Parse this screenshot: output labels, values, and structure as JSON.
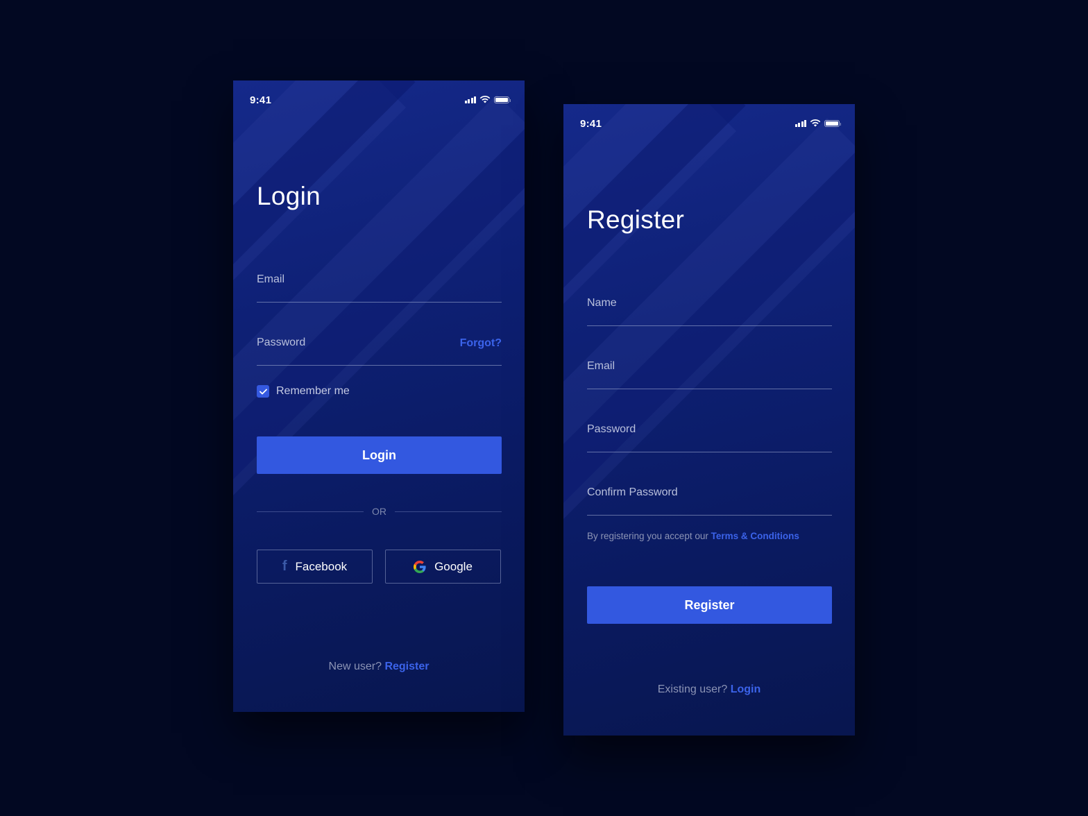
{
  "colors": {
    "background": "#020822",
    "accent": "#3358e0",
    "link": "#3b63ea",
    "label": "#b9c0dc",
    "muted": "#8c94b5"
  },
  "login": {
    "status_bar": {
      "time": "9:41",
      "icons": [
        "signal-icon",
        "wifi-icon",
        "battery-icon"
      ]
    },
    "title": "Login",
    "fields": {
      "email": {
        "label": "Email",
        "value": ""
      },
      "password": {
        "label": "Password",
        "value": ""
      }
    },
    "forgot_label": "Forgot?",
    "remember": {
      "label": "Remember me",
      "checked": true
    },
    "login_button": "Login",
    "divider_label": "OR",
    "social": {
      "facebook": {
        "label": "Facebook",
        "icon": "facebook-icon"
      },
      "google": {
        "label": "Google",
        "icon": "google-icon"
      }
    },
    "footer": {
      "prompt": "New user?",
      "link": "Register"
    }
  },
  "register": {
    "status_bar": {
      "time": "9:41",
      "icons": [
        "signal-icon",
        "wifi-icon",
        "battery-icon"
      ]
    },
    "title": "Register",
    "fields": {
      "name": {
        "label": "Name",
        "value": ""
      },
      "email": {
        "label": "Email",
        "value": ""
      },
      "password": {
        "label": "Password",
        "value": ""
      },
      "confirm_password": {
        "label": "Confirm Password",
        "value": ""
      }
    },
    "terms": {
      "prefix": "By registering you accept our",
      "link": "Terms & Conditions"
    },
    "register_button": "Register",
    "footer": {
      "prompt": "Existing user?",
      "link": "Login"
    }
  }
}
